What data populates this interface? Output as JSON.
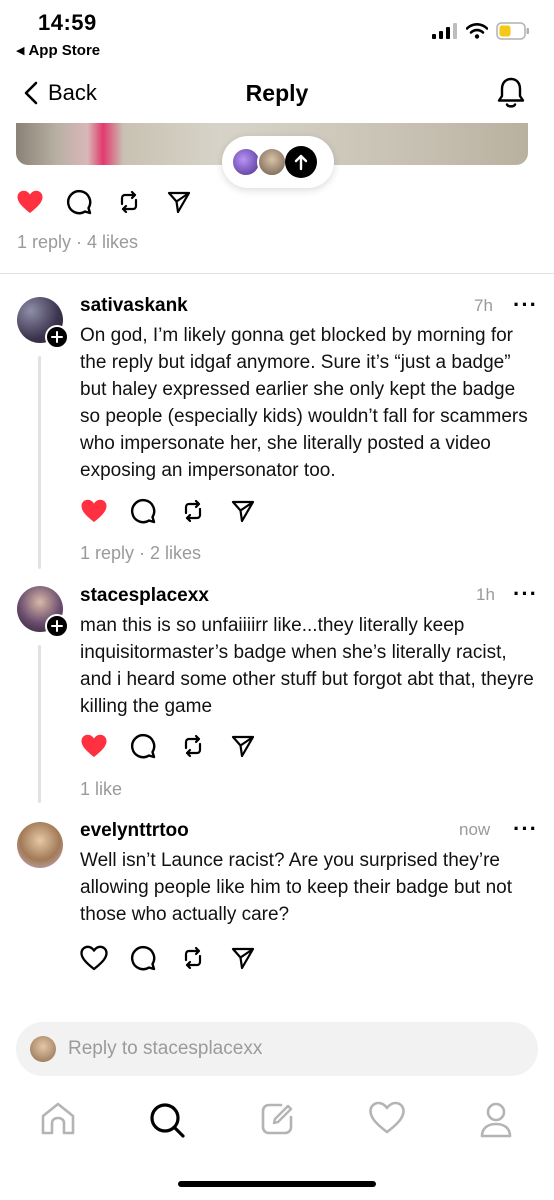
{
  "status_bar": {
    "time": "14:59",
    "back_app": "App Store"
  },
  "nav": {
    "back_label": "Back",
    "title": "Reply"
  },
  "main_post": {
    "stats": "1 reply · 4 likes",
    "liked": true
  },
  "replies": [
    {
      "username": "sativaskank",
      "time": "7h",
      "text": "On god, I’m likely gonna get blocked by morning for the reply but idgaf anymore. Sure it’s “just a badge” but haley expressed earlier she only kept the badge so people (especially kids) wouldn’t fall for scammers who impersonate her, she literally posted a video exposing an impersonator too.",
      "stats": "1 reply · 2 likes",
      "liked": true
    },
    {
      "username": "stacesplacexx",
      "time": "1h",
      "text": "man this is so unfaiiiirr like...they literally keep inquisitormaster’s badge when she’s literally racist, and i heard some other stuff but forgot abt that, theyre killing the game",
      "stats": "1 like",
      "liked": true
    },
    {
      "username": "evelynttrtoo",
      "time": "now",
      "text": "Well isn’t Launce racist? Are you surprised they’re allowing people like him to keep their badge but not those who actually care?",
      "liked": false
    }
  ],
  "reply_input": {
    "placeholder": "Reply to stacesplacexx"
  },
  "colors": {
    "like_red": "#ff3040",
    "muted_gray": "#9a9a9a",
    "divider": "#e3e3e3"
  },
  "icons": [
    "heart-icon",
    "comment-icon",
    "repost-icon",
    "share-icon",
    "bell-icon",
    "home-icon",
    "search-icon",
    "compose-icon",
    "activity-icon",
    "profile-icon"
  ]
}
